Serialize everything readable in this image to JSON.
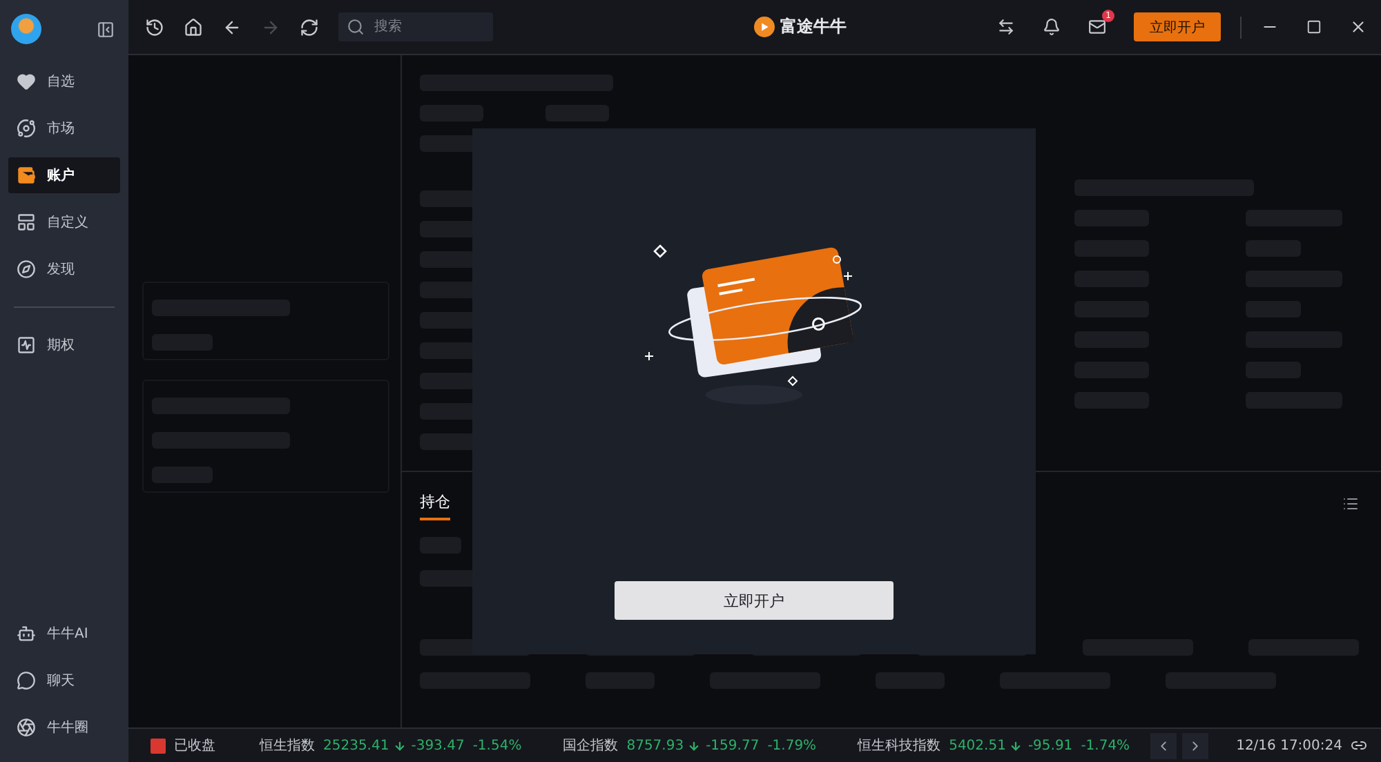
{
  "sidebar": {
    "items": [
      {
        "label": "自选",
        "selected": false
      },
      {
        "label": "市场",
        "selected": false
      },
      {
        "label": "账户",
        "selected": true
      },
      {
        "label": "自定义",
        "selected": false
      },
      {
        "label": "发现",
        "selected": false
      },
      {
        "label": "期权",
        "selected": false
      }
    ],
    "bottom_items": [
      {
        "label": "牛牛AI",
        "selected": false
      },
      {
        "label": "聊天",
        "selected": false
      },
      {
        "label": "牛牛圈",
        "selected": false
      }
    ]
  },
  "toolbar": {
    "nav_buttons": [
      {
        "kind": "history",
        "disabled": false
      },
      {
        "kind": "home",
        "disabled": false
      },
      {
        "kind": "back",
        "disabled": false
      },
      {
        "kind": "forward",
        "disabled": true
      },
      {
        "kind": "refresh",
        "disabled": false
      }
    ],
    "search": {
      "placeholder": "搜索"
    }
  },
  "brand": {
    "name": "富途牛牛"
  },
  "header_actions": {
    "mail_badge": "1",
    "open_account_button": "立即开户"
  },
  "holdings_tabs": [
    {
      "label": "持仓",
      "selected": true
    }
  ],
  "dialog": {
    "button": "立即开户"
  },
  "status_bar": {
    "market_status": "已收盘",
    "indices": [
      {
        "name": "恒生指数",
        "value": "25235.41",
        "change": "-393.47",
        "percent": "-1.54%",
        "kind": "down"
      },
      {
        "name": "国企指数",
        "value": "8757.93",
        "change": "-159.77",
        "percent": "-1.79%",
        "kind": "down"
      },
      {
        "name": "恒生科技指数",
        "value": "5402.51",
        "change": "-95.91",
        "percent": "-1.74%",
        "kind": "down"
      }
    ],
    "time": "12/16 17:00:24"
  }
}
